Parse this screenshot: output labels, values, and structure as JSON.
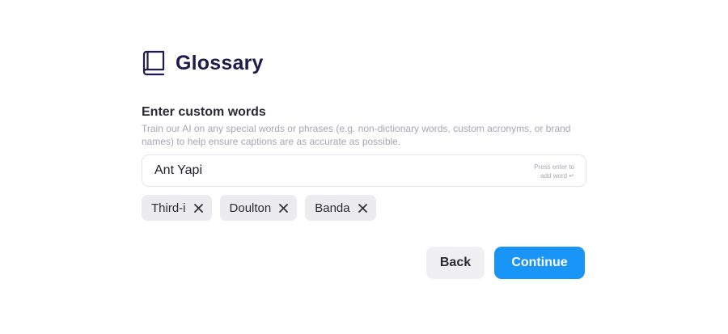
{
  "header": {
    "title": "Glossary",
    "icon": "book-icon"
  },
  "custom_words": {
    "label": "Enter custom words",
    "description": "Train our AI on any special words or phrases (e.g. non-dictionary words, custom acronyms, or brand names) to help ensure captions are as accurate as possible.",
    "input_value": "Ant Yapi",
    "hint_line1": "Press enter to",
    "hint_line2": "add word ↵"
  },
  "chips": [
    {
      "label": "Third-i"
    },
    {
      "label": "Doulton"
    },
    {
      "label": "Banda"
    }
  ],
  "actions": {
    "back_label": "Back",
    "continue_label": "Continue"
  },
  "colors": {
    "title": "#1f1b4d",
    "primary": "#1994f7",
    "chip_bg": "#ececef"
  }
}
